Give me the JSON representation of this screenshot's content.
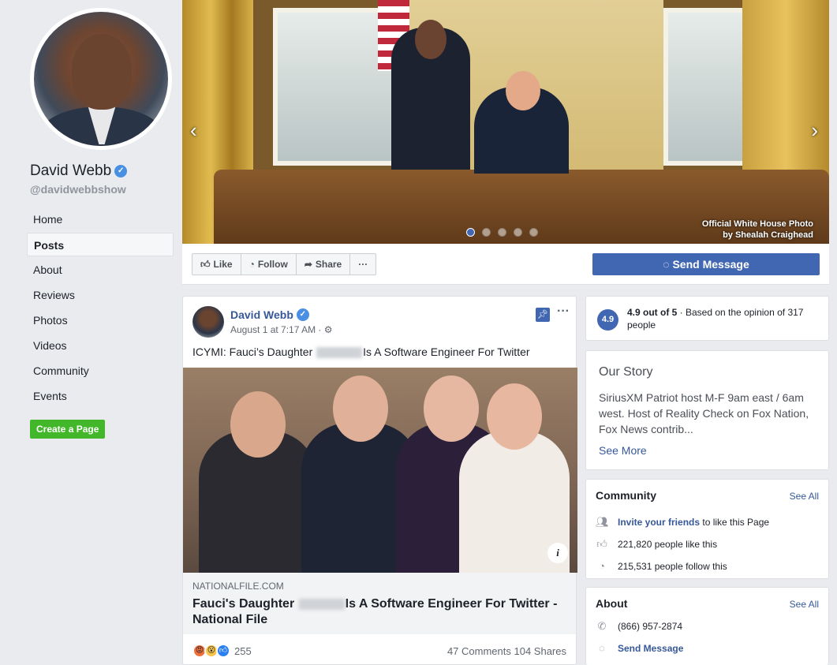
{
  "profile": {
    "name": "David Webb",
    "handle": "@davidwebbshow",
    "create_page": "Create a Page"
  },
  "nav": [
    {
      "label": "Home"
    },
    {
      "label": "Posts"
    },
    {
      "label": "About"
    },
    {
      "label": "Reviews"
    },
    {
      "label": "Photos"
    },
    {
      "label": "Videos"
    },
    {
      "label": "Community"
    },
    {
      "label": "Events"
    }
  ],
  "cover": {
    "caption_line1": "Official White House Photo",
    "caption_line2": "by Shealah Craighead",
    "slides_total": 5,
    "slide_active": 1
  },
  "actions": {
    "like": "Like",
    "follow": "Follow",
    "share": "Share",
    "more": "···",
    "send_message": "Send Message"
  },
  "post": {
    "author": "David Webb",
    "time": "August 1 at 7:17 AM ·",
    "text_before": "ICYMI: Fauci’s Daughter",
    "text_after": "Is A Software Engineer For Twitter",
    "link_domain": "NATIONALFILE.COM",
    "link_title_before": "Fauci's Daughter",
    "link_title_after": "Is A Software Engineer For Twitter - National File",
    "reaction_count": "255",
    "comments": "47 Comments",
    "shares": "104 Shares"
  },
  "rating": {
    "badge": "4.9",
    "score": "4.9 out of 5",
    "detail": " · Based on the opinion of 317 people"
  },
  "story": {
    "title": "Our Story",
    "text": "SiriusXM Patriot host M-F 9am east / 6am west. Host of Reality Check on Fox Nation, Fox News contrib...",
    "see_more": "See More"
  },
  "community": {
    "title": "Community",
    "see_all": "See All",
    "invite_link": "Invite your friends",
    "invite_rest": " to like this Page",
    "likes": "221,820 people like this",
    "follows": "215,531 people follow this"
  },
  "about": {
    "title": "About",
    "see_all": "See All",
    "phone": "(866) 957-2874",
    "send_message": "Send Message"
  },
  "colors": {
    "brand_blue": "#4267b2",
    "link_blue": "#365899",
    "green": "#42b72a",
    "background": "#e9ebee"
  }
}
